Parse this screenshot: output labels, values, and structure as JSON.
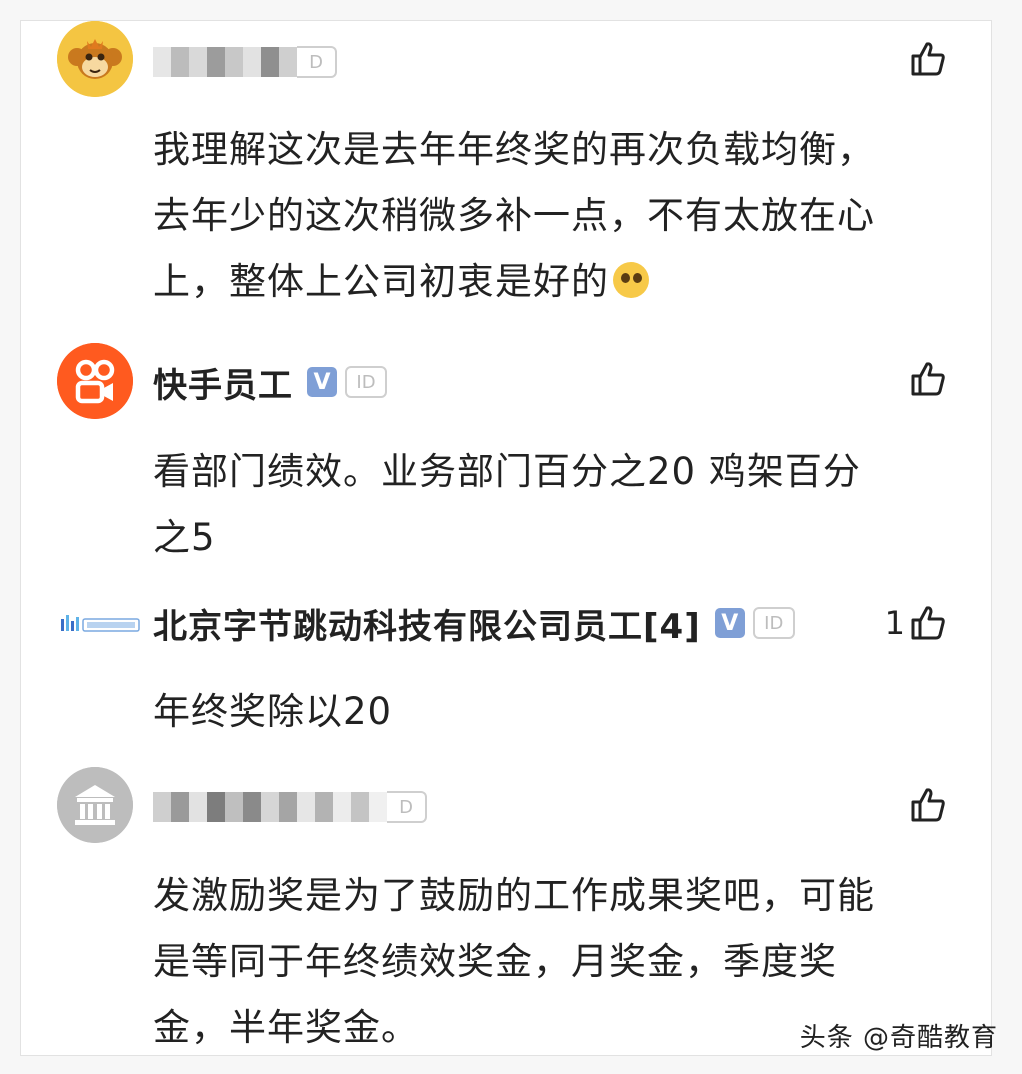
{
  "comments": [
    {
      "username": "",
      "id_badge": "D",
      "body_lines": [
        "我理解这次是去年年终奖的再次负载均衡，",
        "去年少的这次稍微多补一点，不有太放在心",
        "上，整体上公司初衷是好的"
      ],
      "like_count": "",
      "avatar_icon": "monkey-avatar-icon",
      "name_blurred": true
    },
    {
      "username": "快手员工",
      "verified_badge": "V",
      "id_badge": "ID",
      "body_lines": [
        "看部门绩效。业务部门百分之20 鸡架百分",
        "之5"
      ],
      "like_count": "",
      "avatar_icon": "kuaishou-logo-icon"
    },
    {
      "username": "北京字节跳动科技有限公司员工[4]",
      "verified_badge": "V",
      "id_badge": "ID",
      "body_lines": [
        "年终奖除以20"
      ],
      "like_count": "1",
      "avatar_icon": "bytedance-logo-icon"
    },
    {
      "username": "",
      "id_badge": "D",
      "body_lines": [
        "发激励奖是为了鼓励的工作成果奖吧，可能",
        "是等同于年终绩效奖金，月奖金，季度奖",
        "金，半年奖金。"
      ],
      "like_count": "",
      "avatar_icon": "bank-building-icon",
      "name_blurred": true
    }
  ],
  "watermark": "头条 @奇酷教育",
  "colors": {
    "kuaishou_orange": "#ff5a1f",
    "verified_blue": "#7f9fd6",
    "monkey_yellow": "#f4c542"
  }
}
